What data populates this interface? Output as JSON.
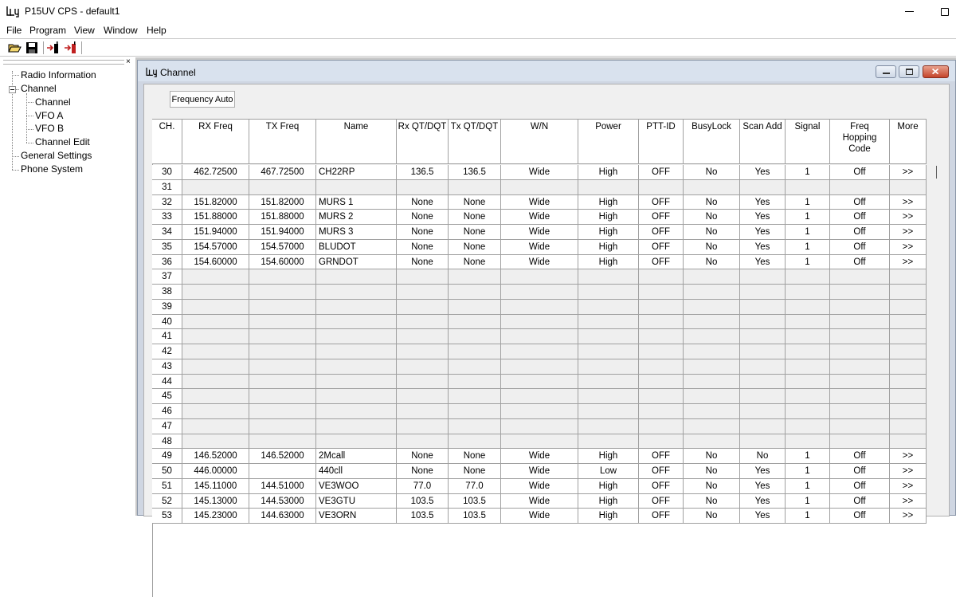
{
  "window": {
    "title": "P15UV CPS - default1"
  },
  "menu": {
    "items": [
      "File",
      "Program",
      "View",
      "Window",
      "Help"
    ]
  },
  "toolbar": {
    "icons": [
      "open-folder-icon",
      "save-icon",
      "read-from-radio-icon",
      "write-to-radio-icon"
    ]
  },
  "tree": {
    "close_glyph": "×",
    "items": {
      "radio_information": "Radio Information",
      "channel": "Channel",
      "channel_child": "Channel",
      "vfo_a": "VFO A",
      "vfo_b": "VFO B",
      "channel_edit": "Channel Edit",
      "general_settings": "General Settings",
      "phone_system": "Phone System"
    }
  },
  "child": {
    "title": "Channel",
    "frequency_auto_label": "Frequency Auto"
  },
  "grid": {
    "columns": [
      "CH.",
      "RX Freq",
      "TX Freq",
      "Name",
      "Rx QT/DQT",
      "Tx QT/DQT",
      "W/N",
      "Power",
      "PTT-ID",
      "BusyLock",
      "Scan Add",
      "Signal",
      "Freq Hopping Code",
      "More"
    ],
    "rows": [
      [
        "30",
        "462.72500",
        "467.72500",
        "CH22RP",
        "136.5",
        "136.5",
        "Wide",
        "High",
        "OFF",
        "No",
        "Yes",
        "1",
        "Off",
        ">>"
      ],
      [
        "31",
        "",
        "",
        "",
        "",
        "",
        "",
        "",
        "",
        "",
        "",
        "",
        "",
        ""
      ],
      [
        "32",
        "151.82000",
        "151.82000",
        "MURS 1",
        "None",
        "None",
        "Wide",
        "High",
        "OFF",
        "No",
        "Yes",
        "1",
        "Off",
        ">>"
      ],
      [
        "33",
        "151.88000",
        "151.88000",
        "MURS 2",
        "None",
        "None",
        "Wide",
        "High",
        "OFF",
        "No",
        "Yes",
        "1",
        "Off",
        ">>"
      ],
      [
        "34",
        "151.94000",
        "151.94000",
        "MURS 3",
        "None",
        "None",
        "Wide",
        "High",
        "OFF",
        "No",
        "Yes",
        "1",
        "Off",
        ">>"
      ],
      [
        "35",
        "154.57000",
        "154.57000",
        "BLUDOT",
        "None",
        "None",
        "Wide",
        "High",
        "OFF",
        "No",
        "Yes",
        "1",
        "Off",
        ">>"
      ],
      [
        "36",
        "154.60000",
        "154.60000",
        "GRNDOT",
        "None",
        "None",
        "Wide",
        "High",
        "OFF",
        "No",
        "Yes",
        "1",
        "Off",
        ">>"
      ],
      [
        "37",
        "",
        "",
        "",
        "",
        "",
        "",
        "",
        "",
        "",
        "",
        "",
        "",
        ""
      ],
      [
        "38",
        "",
        "",
        "",
        "",
        "",
        "",
        "",
        "",
        "",
        "",
        "",
        "",
        ""
      ],
      [
        "39",
        "",
        "",
        "",
        "",
        "",
        "",
        "",
        "",
        "",
        "",
        "",
        "",
        ""
      ],
      [
        "40",
        "",
        "",
        "",
        "",
        "",
        "",
        "",
        "",
        "",
        "",
        "",
        "",
        ""
      ],
      [
        "41",
        "",
        "",
        "",
        "",
        "",
        "",
        "",
        "",
        "",
        "",
        "",
        "",
        ""
      ],
      [
        "42",
        "",
        "",
        "",
        "",
        "",
        "",
        "",
        "",
        "",
        "",
        "",
        "",
        ""
      ],
      [
        "43",
        "",
        "",
        "",
        "",
        "",
        "",
        "",
        "",
        "",
        "",
        "",
        "",
        ""
      ],
      [
        "44",
        "",
        "",
        "",
        "",
        "",
        "",
        "",
        "",
        "",
        "",
        "",
        "",
        ""
      ],
      [
        "45",
        "",
        "",
        "",
        "",
        "",
        "",
        "",
        "",
        "",
        "",
        "",
        "",
        ""
      ],
      [
        "46",
        "",
        "",
        "",
        "",
        "",
        "",
        "",
        "",
        "",
        "",
        "",
        "",
        ""
      ],
      [
        "47",
        "",
        "",
        "",
        "",
        "",
        "",
        "",
        "",
        "",
        "",
        "",
        "",
        ""
      ],
      [
        "48",
        "",
        "",
        "",
        "",
        "",
        "",
        "",
        "",
        "",
        "",
        "",
        "",
        ""
      ],
      [
        "49",
        "146.52000",
        "146.52000",
        "2Mcall",
        "None",
        "None",
        "Wide",
        "High",
        "OFF",
        "No",
        "No",
        "1",
        "Off",
        ">>"
      ],
      [
        "50",
        "446.00000",
        "",
        "440cll",
        "None",
        "None",
        "Wide",
        "Low",
        "OFF",
        "No",
        "Yes",
        "1",
        "Off",
        ">>"
      ],
      [
        "51",
        "145.11000",
        "144.51000",
        "VE3WOO",
        "77.0",
        "77.0",
        "Wide",
        "High",
        "OFF",
        "No",
        "Yes",
        "1",
        "Off",
        ">>"
      ],
      [
        "52",
        "145.13000",
        "144.53000",
        "VE3GTU",
        "103.5",
        "103.5",
        "Wide",
        "High",
        "OFF",
        "No",
        "Yes",
        "1",
        "Off",
        ">>"
      ],
      [
        "53",
        "145.23000",
        "144.63000",
        "VE3ORN",
        "103.5",
        "103.5",
        "Wide",
        "High",
        "OFF",
        "No",
        "Yes",
        "1",
        "Off",
        ">>"
      ]
    ]
  }
}
